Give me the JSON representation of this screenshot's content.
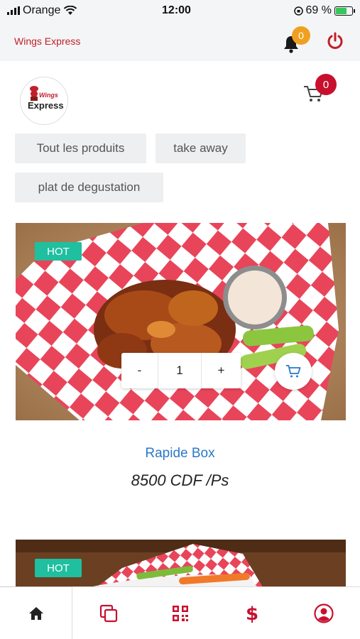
{
  "status_bar": {
    "carrier": "Orange",
    "time": "12:00",
    "battery_text": "69 %"
  },
  "header": {
    "app_title": "Wings Express",
    "notification_count": "0"
  },
  "logo": {
    "top_text": "Wings",
    "text": "Express"
  },
  "cart": {
    "count": "0"
  },
  "categories": [
    {
      "label": "Tout les produits"
    },
    {
      "label": "take away"
    },
    {
      "label": "plat de degustation"
    }
  ],
  "products": [
    {
      "badge": "HOT",
      "quantity": "1",
      "minus_label": "-",
      "plus_label": "+",
      "name": "Rapide Box",
      "price": "8500 CDF /Ps"
    },
    {
      "badge": "HOT"
    }
  ],
  "bottom_nav": [
    {
      "icon": "home-icon",
      "active": true
    },
    {
      "icon": "copy-icon",
      "active": false
    },
    {
      "icon": "qr-code-icon",
      "active": false
    },
    {
      "icon": "dollar-icon",
      "active": false
    },
    {
      "icon": "user-circle-icon",
      "active": false
    }
  ],
  "colors": {
    "brand_red": "#c0202a",
    "accent_orange": "#f0a020",
    "hot_badge": "#1fbf9f",
    "product_name_blue": "#2a78c8"
  }
}
